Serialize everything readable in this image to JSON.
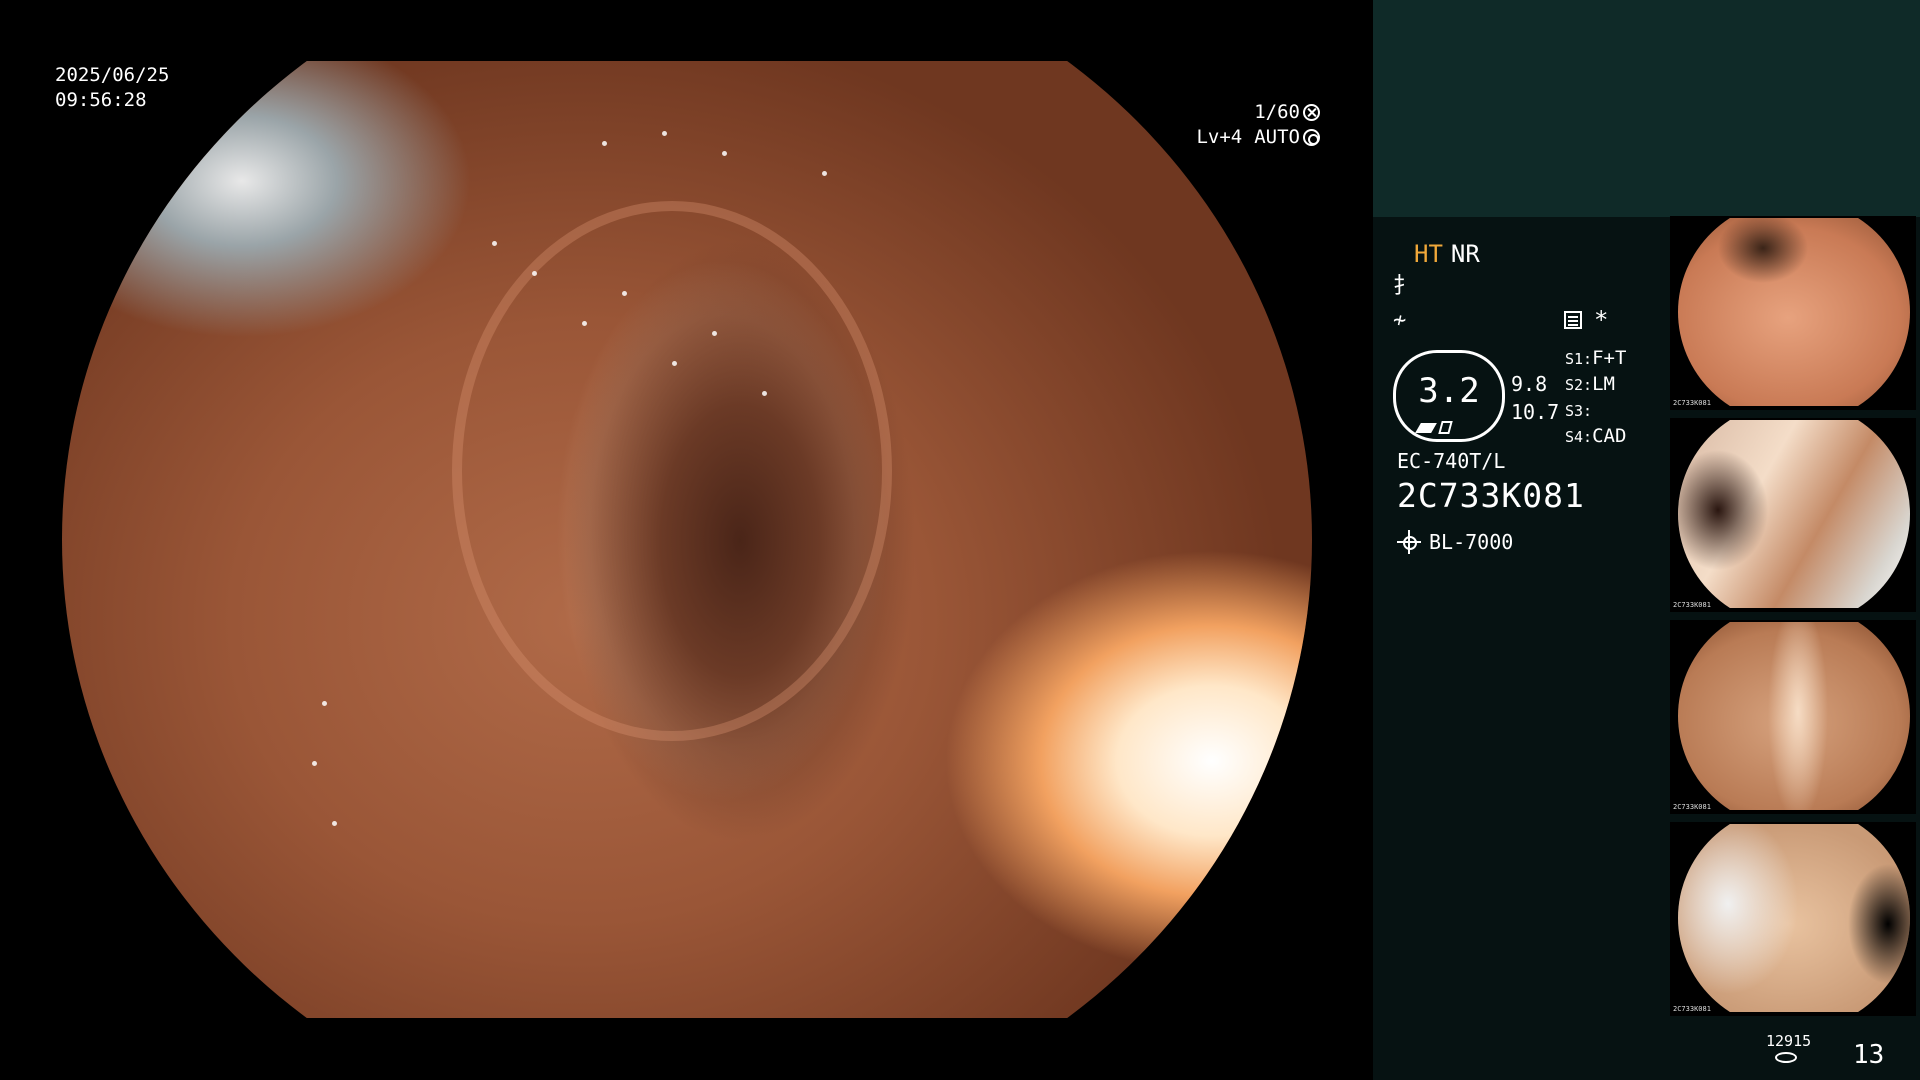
{
  "overlay": {
    "date": "2025/06/25",
    "time": "09:56:28",
    "shutter": "1/60",
    "level": "Lv+4",
    "iris_mode": "AUTO"
  },
  "panel": {
    "mode_ht": "HT",
    "mode_nr": "NR",
    "symbol_1": "⺘",
    "symbol_2": "≁",
    "preset_star": "*",
    "zoom": "3.2",
    "zoom_values": [
      "9.8",
      "10.7"
    ],
    "switches": [
      {
        "key": "S1:",
        "value": "F+T"
      },
      {
        "key": "S2:",
        "value": "LM"
      },
      {
        "key": "S3:",
        "value": ""
      },
      {
        "key": "S4:",
        "value": "CAD"
      }
    ],
    "scope_model": "EC-740T/L",
    "scope_serial": "2C733K081",
    "light_source": "BL-7000",
    "capture_count": "12915",
    "image_count": "13"
  },
  "thumbnails": [
    {
      "tag": "2C733K081"
    },
    {
      "tag": "2C733K081"
    },
    {
      "tag": "2C733K081"
    },
    {
      "tag": "2C733K081"
    }
  ],
  "icons": {
    "shutter": "shutter-icon",
    "iris": "iris-icon",
    "light": "light-source-icon",
    "preset": "preset-list-icon",
    "storage": "disk-icon"
  }
}
